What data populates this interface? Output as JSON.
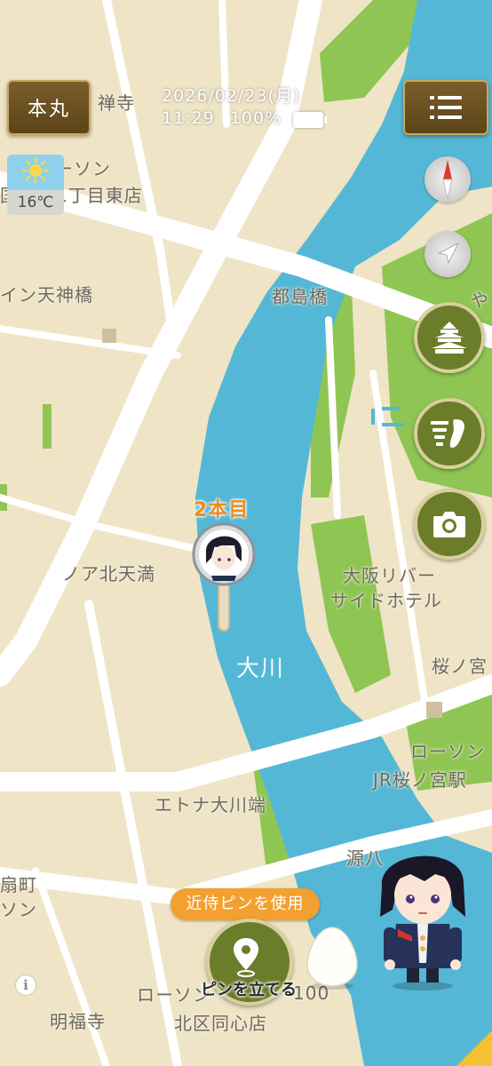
{
  "header": {
    "honmaru_label": "本丸",
    "date": "2026/02/23(月)",
    "time": "11:29",
    "battery_percent": "100%",
    "battery_level": 1.0
  },
  "weather": {
    "condition_icon": "sun-icon",
    "temperature": "16℃"
  },
  "map": {
    "labels": [
      {
        "id": "label-zenji",
        "text": "禅寺"
      },
      {
        "id": "label-lawson-top",
        "text": "ーソン"
      },
      {
        "id": "label-chome-higashi",
        "text": "国分寺1丁目東店"
      },
      {
        "id": "label-inn-tenjinbashi",
        "text": "イン天神橋"
      },
      {
        "id": "label-miyakojimabashi",
        "text": "都島橋"
      },
      {
        "id": "label-ya",
        "text": "や"
      },
      {
        "id": "label-noa-kitatenma",
        "text": "ノア北天満"
      },
      {
        "id": "label-osaka-river1",
        "text": "大阪リバー"
      },
      {
        "id": "label-osaka-river2",
        "text": "サイドホテル"
      },
      {
        "id": "label-okawa",
        "text": "大川"
      },
      {
        "id": "label-sakuranomiya",
        "text": "桜ノ宮"
      },
      {
        "id": "label-lawson-jr1",
        "text": "ローソン"
      },
      {
        "id": "label-lawson-jr2",
        "text": "JR桜ノ宮駅"
      },
      {
        "id": "label-etona",
        "text": "エトナ大川端"
      },
      {
        "id": "label-genpachi",
        "text": "源八"
      },
      {
        "id": "label-machi",
        "text": "扇町"
      },
      {
        "id": "label-son",
        "text": "ソン"
      },
      {
        "id": "label-lawson-bottom",
        "text": "ローソン"
      },
      {
        "id": "label-100",
        "text": "100"
      },
      {
        "id": "label-myofukuji",
        "text": "明福寺"
      },
      {
        "id": "label-kitaku",
        "text": "北区同心店"
      }
    ]
  },
  "pin": {
    "label": "2本目"
  },
  "actions": {
    "kinji_pin_label": "近侍ピンを使用",
    "set_pin_label": "ピンを立てる"
  },
  "buttons": {
    "compass_icon": "compass-icon",
    "locate_icon": "location-arrow-icon",
    "castle_icon": "castle-icon",
    "scroll_icon": "scroll-icon",
    "camera_icon": "camera-icon",
    "menu_icon": "menu-list-icon",
    "info_icon": "i"
  },
  "colors": {
    "land": "#efe4c6",
    "river": "#55b7d6",
    "park": "#8fc653",
    "road": "#ffffff",
    "accent_green": "#6b7d2a",
    "accent_orange": "#f2a02f"
  }
}
